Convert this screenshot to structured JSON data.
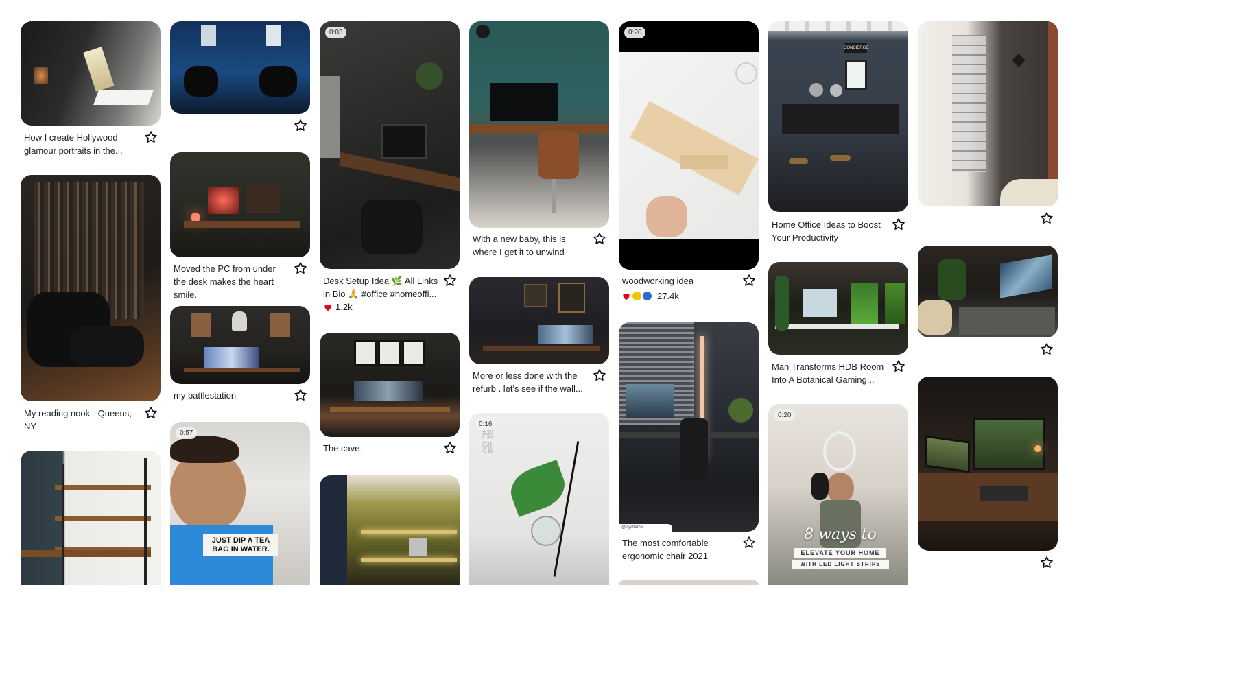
{
  "pins": {
    "p1": {
      "title": "How I create Hollywood glamour portraits in the..."
    },
    "p2": {
      "title": "My reading nook - Queens, NY"
    },
    "p3": {
      "title": ""
    },
    "p4": {
      "title": ""
    },
    "p5": {
      "title": "Moved the PC from under the desk makes the heart smile."
    },
    "p6": {
      "title": "my battlestation"
    },
    "p7": {
      "duration": "0:57",
      "overlay": "JUST DIP A TEA BAG IN WATER."
    },
    "p8": {
      "duration": "0:03",
      "title": "Desk Setup Idea 🌿 All Links in Bio 🙏 #office #homeoffi...",
      "reactions": "1.2k"
    },
    "p9": {
      "title": "The cave."
    },
    "p10": {
      "title": ""
    },
    "p11": {
      "title": "With a new baby, this is where I get it to unwind"
    },
    "p12": {
      "title": "More or less done with the refurb . let's see if the wall..."
    },
    "p13": {
      "duration": "0:16",
      "overlay": "翔 雅"
    },
    "p14": {
      "duration": "0:20",
      "title": "woodworking idea",
      "reactions": "27.4k"
    },
    "p15": {
      "title": "The most comfortable ergonomic chair 2021",
      "watermark": "@lilyshome"
    },
    "p16": {
      "title": "Home Office Ideas to Boost Your Productivity",
      "sign": "CONCIERGE"
    },
    "p17": {
      "title": "Man Transforms HDB Room Into A Botanical Gaming..."
    },
    "p18": {
      "duration": "0:20",
      "overlay_line1": "8 ways to",
      "overlay_line2": "ELEVATE YOUR HOME",
      "overlay_line3": "WITH LED LIGHT STRIPS"
    },
    "p19": {
      "title": ""
    },
    "p20": {
      "title": ""
    },
    "p21": {
      "title": ""
    }
  },
  "icons": {
    "save": "star-outline-icon",
    "react_love": "heart-icon",
    "react_wow": "surprised-face-icon",
    "react_idea": "lightbulb-icon"
  },
  "colors": {
    "background": "#ffffff",
    "text": "#222222",
    "heart": "#e60023"
  }
}
